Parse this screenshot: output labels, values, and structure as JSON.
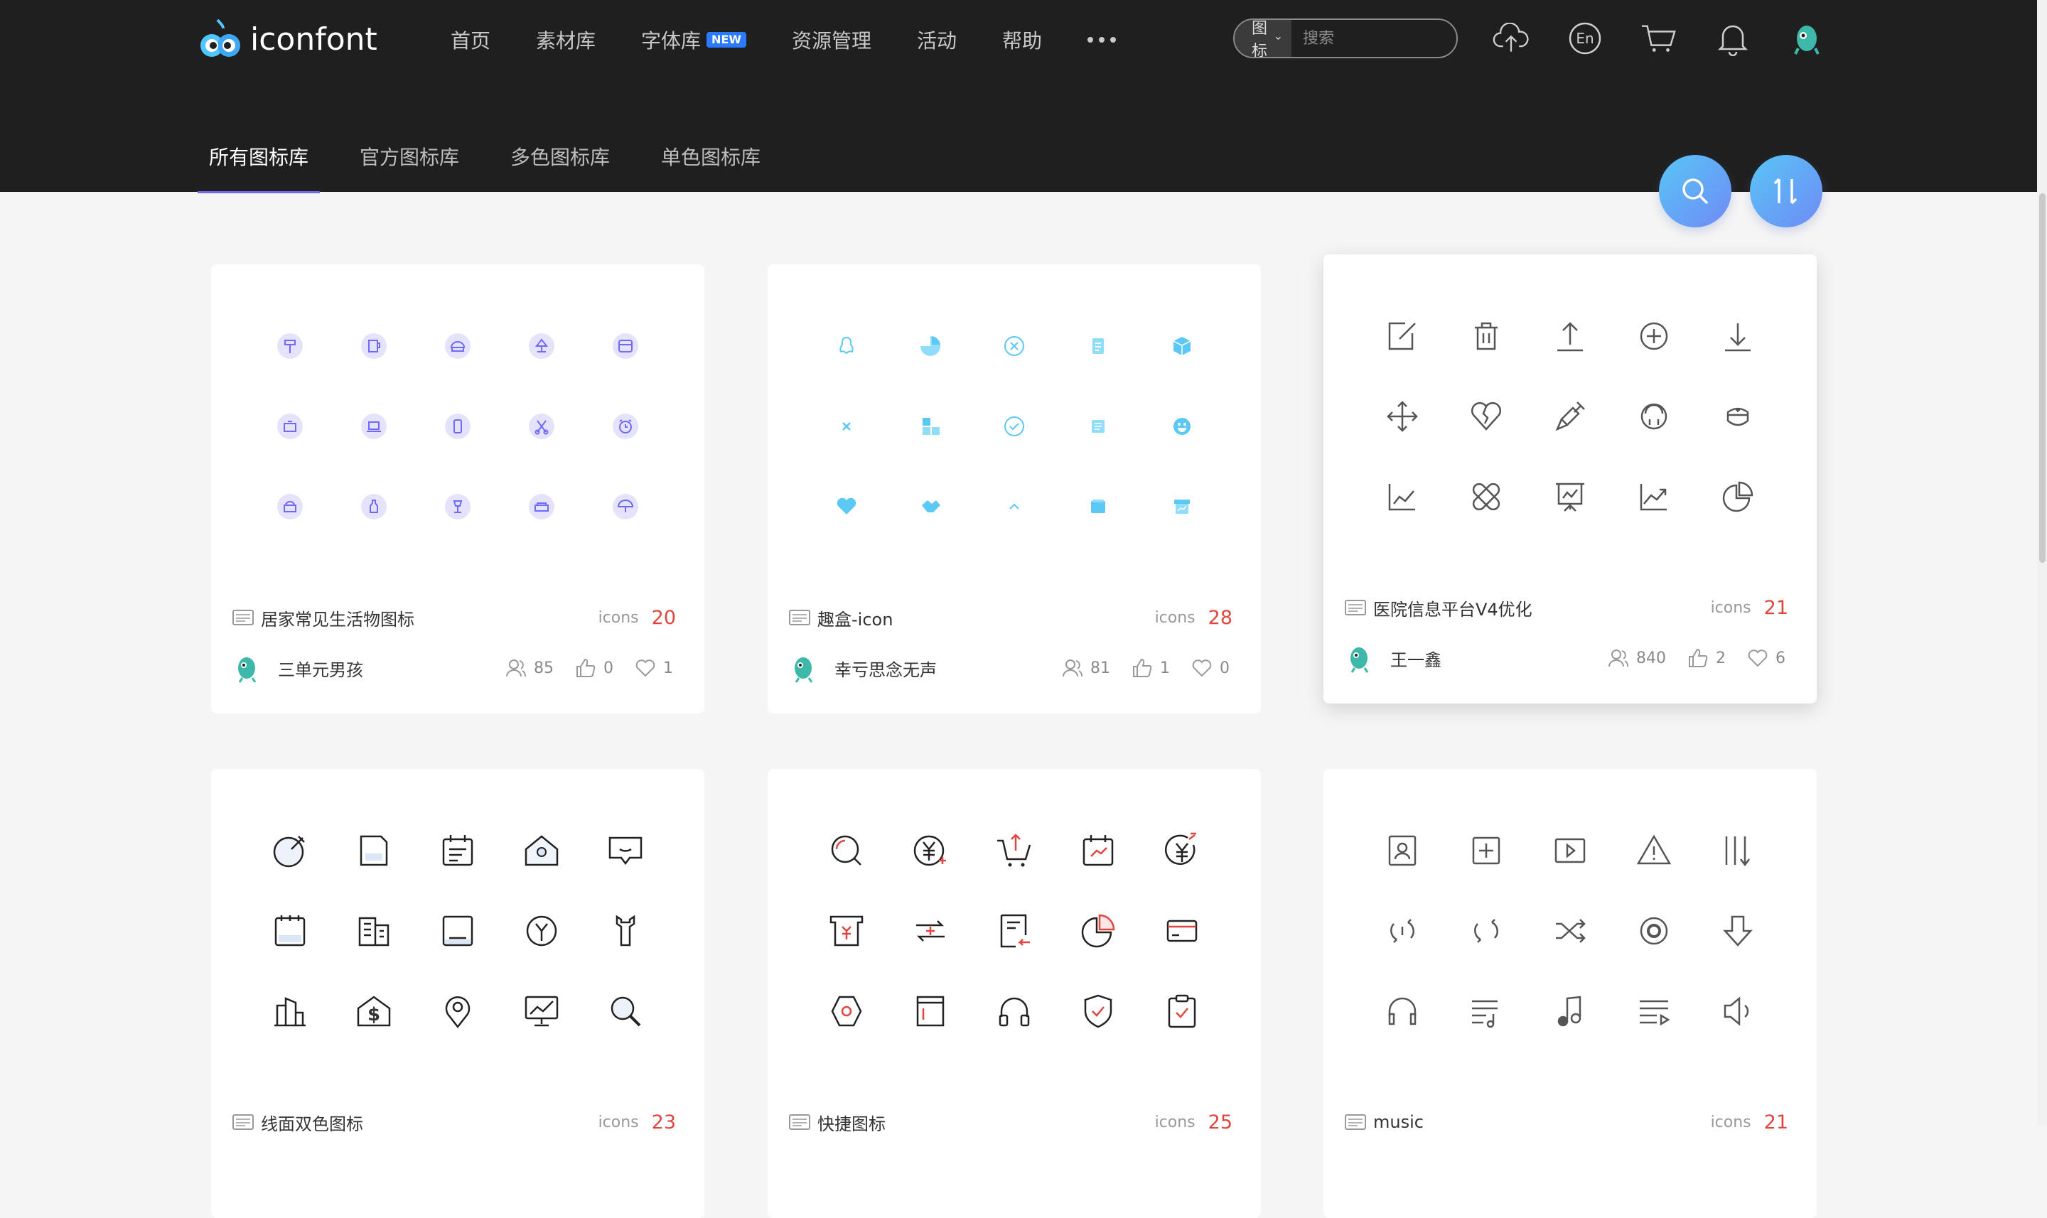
{
  "header": {
    "logo_text": "iconfont",
    "nav": [
      {
        "label": "首页"
      },
      {
        "label": "素材库"
      },
      {
        "label": "字体库",
        "badge": "NEW"
      },
      {
        "label": "资源管理"
      },
      {
        "label": "活动"
      },
      {
        "label": "帮助"
      }
    ],
    "search": {
      "type_label": "图标",
      "placeholder": "搜索"
    },
    "icons": [
      "upload-cloud-icon",
      "language-en-icon",
      "cart-icon",
      "bell-icon",
      "user-avatar"
    ],
    "lang_label": "En"
  },
  "tabs": [
    {
      "label": "所有图标库",
      "active": true
    },
    {
      "label": "官方图标库",
      "active": false
    },
    {
      "label": "多色图标库",
      "active": false
    },
    {
      "label": "单色图标库",
      "active": false
    }
  ],
  "fabs": {
    "search": "search-icon",
    "sort": "sort-icon"
  },
  "cards": [
    {
      "name": "居家常见生活物图标",
      "icons_label": "icons",
      "count": "20",
      "author": "三单元男孩",
      "views": "85",
      "likes": "0",
      "favorites": "1",
      "style": "purple"
    },
    {
      "name": "趣盒-icon",
      "icons_label": "icons",
      "count": "28",
      "author": "幸亏思念无声",
      "views": "81",
      "likes": "1",
      "favorites": "0",
      "style": "cyan"
    },
    {
      "name": "医院信息平台V4优化",
      "icons_label": "icons",
      "count": "21",
      "author": "王一鑫",
      "views": "840",
      "likes": "2",
      "favorites": "6",
      "style": "gray"
    },
    {
      "name": "线面双色图标",
      "icons_label": "icons",
      "count": "23",
      "style": "dark"
    },
    {
      "name": "快捷图标",
      "icons_label": "icons",
      "count": "25",
      "style": "red"
    },
    {
      "name": "music",
      "icons_label": "icons",
      "count": "21",
      "style": "gray2"
    }
  ],
  "colors": {
    "accent": "#6f6af5",
    "count_red": "#e0463d",
    "topbar": "#1f1f1f"
  }
}
